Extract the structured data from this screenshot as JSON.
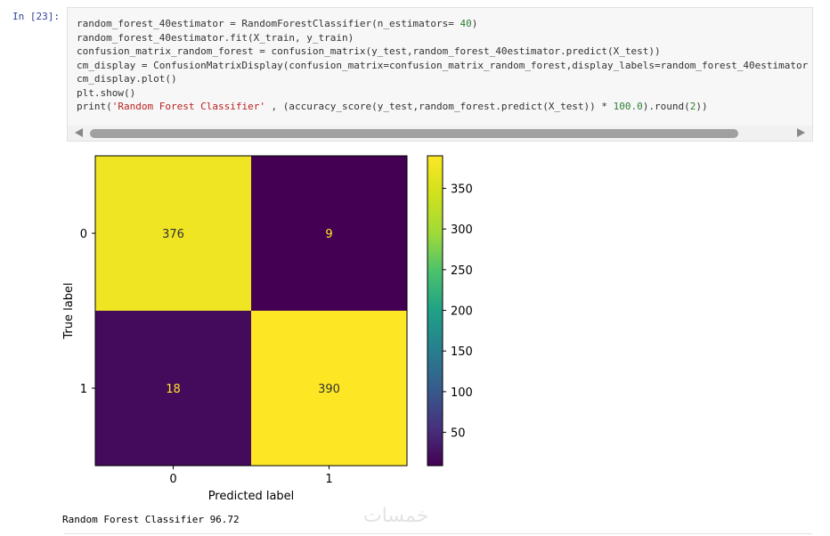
{
  "cell": {
    "prompt": "In [23]:",
    "code_lines": [
      [
        {
          "t": "random_forest_40estimator = RandomForestClassifier(n_estimators= "
        },
        {
          "t": "40",
          "c": "num"
        },
        {
          "t": ")"
        }
      ],
      [
        {
          "t": "random_forest_40estimator.fit(X_train, y_train)"
        }
      ],
      [
        {
          "t": "confusion_matrix_random_forest = confusion_matrix(y_test,random_forest_40estimator.predict(X_test))"
        }
      ],
      [
        {
          "t": "cm_display = ConfusionMatrixDisplay(confusion_matrix=confusion_matrix_random_forest,display_labels=random_forest_40estimator"
        }
      ],
      [
        {
          "t": "cm_display.plot()"
        }
      ],
      [
        {
          "t": "plt.show()"
        }
      ],
      [
        {
          "t": "print("
        },
        {
          "t": "'Random Forest Classifier'",
          "c": "str"
        },
        {
          "t": " , (accuracy_score(y_test,random_forest.predict(X_test)) * "
        },
        {
          "t": "100.0",
          "c": "num"
        },
        {
          "t": ").round("
        },
        {
          "t": "2",
          "c": "num"
        },
        {
          "t": "))"
        }
      ]
    ]
  },
  "chart_data": {
    "type": "heatmap",
    "xlabel": "Predicted label",
    "ylabel": "True label",
    "x_categories": [
      "0",
      "1"
    ],
    "y_categories": [
      "0",
      "1"
    ],
    "values": [
      [
        376,
        9
      ],
      [
        18,
        390
      ]
    ],
    "colormap": "viridis",
    "colorbar": {
      "ticks": [
        50,
        100,
        150,
        200,
        250,
        300,
        350
      ],
      "range": [
        9,
        390
      ]
    }
  },
  "output": {
    "text": "Random Forest Classifier 96.72"
  },
  "watermark": "خمسات"
}
